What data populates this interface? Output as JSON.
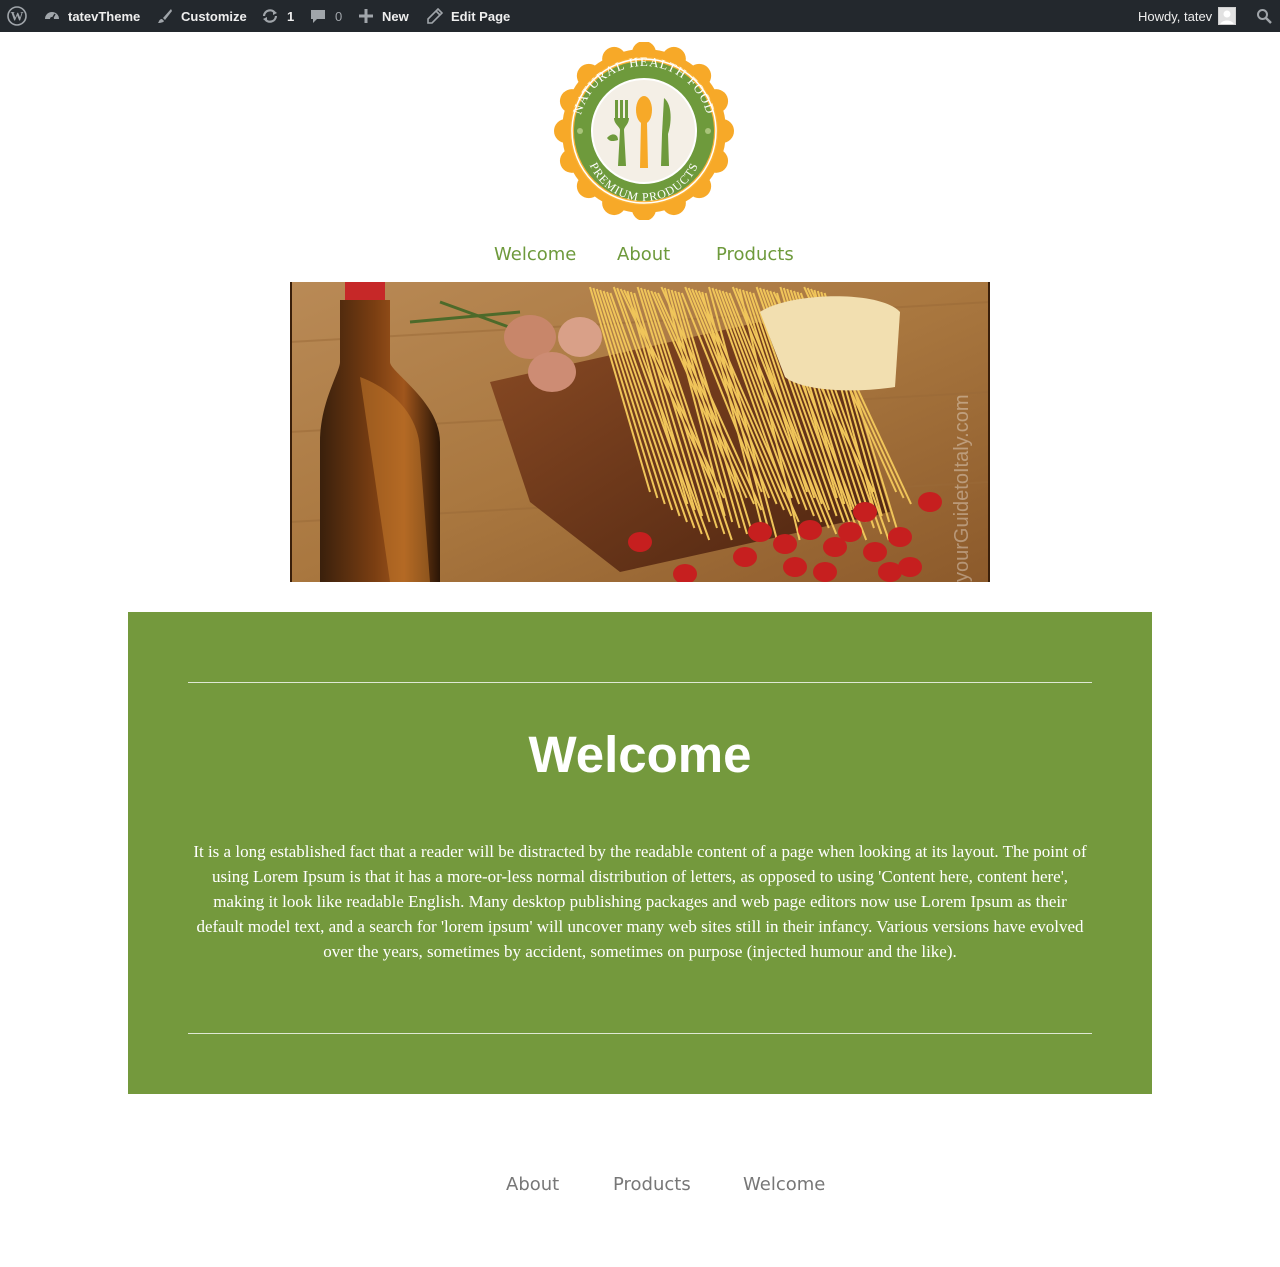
{
  "admin_bar": {
    "site_name": "tatevTheme",
    "customize": "Customize",
    "updates_count": "1",
    "comments_count": "0",
    "new": "New",
    "edit_page": "Edit Page",
    "greeting": "Howdy, tatev"
  },
  "logo": {
    "top_text": "NATURAL HEALTH FOOD",
    "bottom_text": "PREMIUM PRODUCTS",
    "colors": {
      "badge": "#f7a928",
      "ring": "#6e9a3c",
      "center": "#f4efe6"
    }
  },
  "nav": {
    "items": [
      "Welcome",
      "About",
      "Products"
    ]
  },
  "hero": {
    "watermark": "yourGuidetoItaly.com"
  },
  "welcome": {
    "title": "Welcome",
    "body": "It is a long established fact that a reader will be distracted by the readable content of a page when looking at its layout. The point of using Lorem Ipsum is that it has a more-or-less normal distribution of letters, as opposed to using 'Content here, content here', making it look like readable English. Many desktop publishing packages and web page editors now use Lorem Ipsum as their default model text, and a search for 'lorem ipsum' will uncover many web sites still in their infancy. Various versions have evolved over the years, sometimes by accident, sometimes on purpose (injected humour and the like)."
  },
  "footer_nav": {
    "items": [
      "About",
      "Products",
      "Welcome"
    ]
  },
  "colors": {
    "accent_green": "#74993d",
    "admin_bar": "#23282d",
    "footer_link": "#777777"
  }
}
